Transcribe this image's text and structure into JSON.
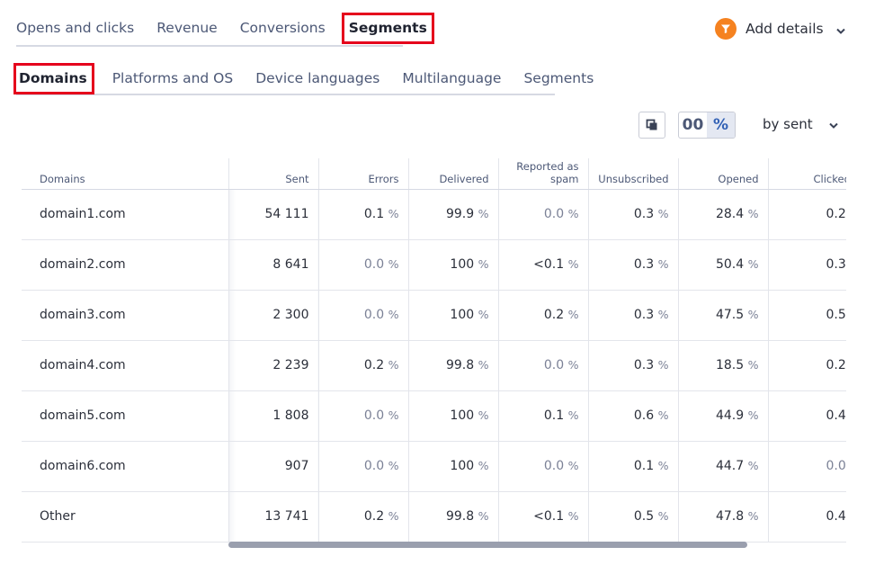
{
  "top_tabs": [
    "Opens and clicks",
    "Revenue",
    "Conversions",
    "Segments"
  ],
  "add_details": {
    "label": "Add details",
    "icon": "funnel-icon",
    "accent": "#f58220"
  },
  "sub_tabs": [
    "Domains",
    "Platforms and OS",
    "Device languages",
    "Multilanguage",
    "Segments"
  ],
  "toolbar": {
    "toggle_numbers": "00",
    "toggle_percent": "%",
    "sort_label": "by sent"
  },
  "table": {
    "headers": [
      "Domains",
      "Sent",
      "Errors",
      "Delivered",
      "Reported as spam",
      "Unsubscribed",
      "Opened",
      "Clicked"
    ],
    "percent_sign": "%",
    "rows": [
      {
        "domain": "domain1.com",
        "sent": "54 111",
        "errors": "0.1",
        "delivered": "99.9",
        "spam": "0.0",
        "unsubscribed": "0.3",
        "opened": "28.4",
        "clicked": "0.2"
      },
      {
        "domain": "domain2.com",
        "sent": "8 641",
        "errors": "0.0",
        "delivered": "100",
        "spam": "<0.1",
        "unsubscribed": "0.3",
        "opened": "50.4",
        "clicked": "0.3"
      },
      {
        "domain": "domain3.com",
        "sent": "2 300",
        "errors": "0.0",
        "delivered": "100",
        "spam": "0.2",
        "unsubscribed": "0.3",
        "opened": "47.5",
        "clicked": "0.5"
      },
      {
        "domain": "domain4.com",
        "sent": "2 239",
        "errors": "0.2",
        "delivered": "99.8",
        "spam": "0.0",
        "unsubscribed": "0.3",
        "opened": "18.5",
        "clicked": "0.2"
      },
      {
        "domain": "domain5.com",
        "sent": "1 808",
        "errors": "0.0",
        "delivered": "100",
        "spam": "0.1",
        "unsubscribed": "0.6",
        "opened": "44.9",
        "clicked": "0.4"
      },
      {
        "domain": "domain6.com",
        "sent": "907",
        "errors": "0.0",
        "delivered": "100",
        "spam": "0.0",
        "unsubscribed": "0.1",
        "opened": "44.7",
        "clicked": "0.0"
      },
      {
        "domain": "Other",
        "sent": "13 741",
        "errors": "0.2",
        "delivered": "99.8",
        "spam": "<0.1",
        "unsubscribed": "0.5",
        "opened": "47.8",
        "clicked": "0.4"
      }
    ]
  }
}
